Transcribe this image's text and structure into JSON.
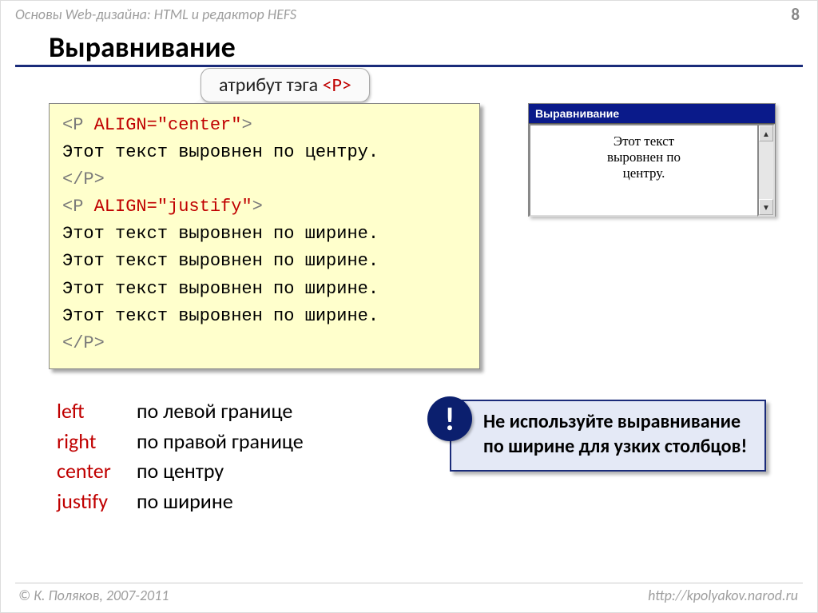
{
  "header": "Основы Web-дизайна: HTML и редактор HEFS",
  "page_number": "8",
  "title": "Выравнивание",
  "callout": {
    "pre": "атрибут тэга ",
    "tag": "<P>"
  },
  "code": {
    "line1": {
      "a": "<P ",
      "b": "ALIGN=\"center\"",
      "c": ">"
    },
    "line2": "Этот текст выровнен по центру.",
    "line3": "</P>",
    "line4": {
      "a": "<P ",
      "b": "ALIGN=\"justify\"",
      "c": ">"
    },
    "line5": "Этот текст выровнен по ширине.",
    "line6": "Этот текст выровнен по ширине.",
    "line7": "Этот текст выровнен по ширине.",
    "line8": "Этот текст выровнен по ширине.",
    "line9": "</P>"
  },
  "legend": [
    {
      "key": "left",
      "desc": "по левой границе"
    },
    {
      "key": "right",
      "desc": "по правой границе"
    },
    {
      "key": "center",
      "desc": "по центру"
    },
    {
      "key": "justify",
      "desc": "по ширине"
    }
  ],
  "preview": {
    "title": "Выравнивание",
    "body_l1": "Этот текст",
    "body_l2": "выровнен по",
    "body_l3": "центру."
  },
  "warning_mark": "!",
  "warning_text": "Не используйте выравнивание по ширине для узких столбцов!",
  "footer_left": "© К. Поляков, 2007-2011",
  "footer_right": "http://kpolyakov.narod.ru"
}
